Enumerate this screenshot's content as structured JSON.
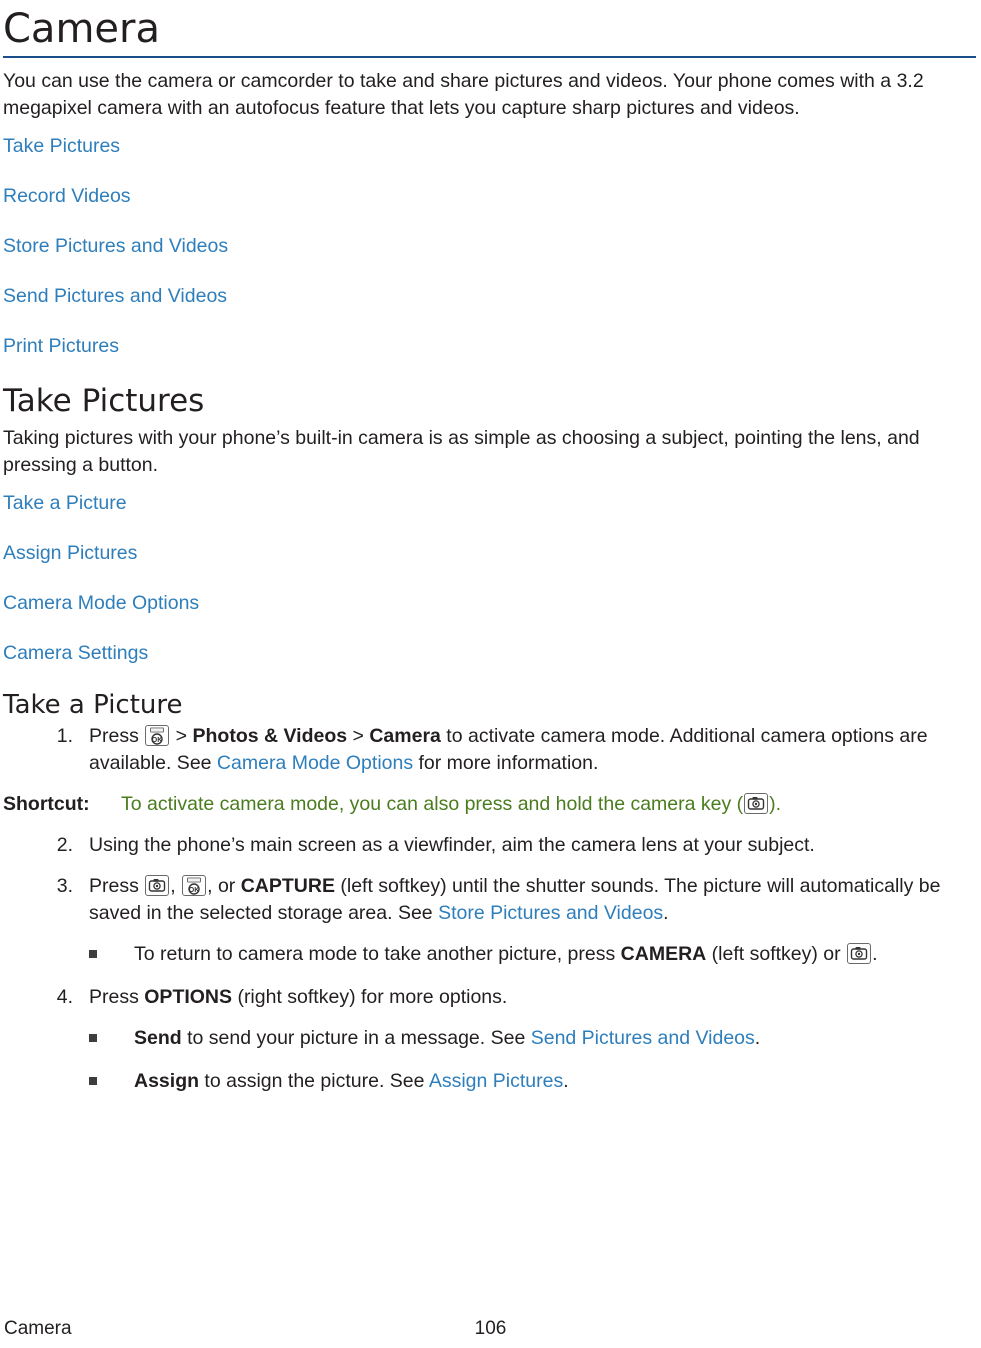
{
  "document": {
    "chapter_title": "Camera",
    "intro": "You can use the camera or camcorder to take and share pictures and videos. Your phone comes with a 3.2 megapixel camera with an autofocus feature that lets you capture sharp pictures and videos.",
    "toc_links": [
      "Take Pictures",
      "Record Videos",
      "Store Pictures and Videos",
      "Send Pictures and Videos",
      "Print Pictures"
    ],
    "section_take_pictures": {
      "heading": "Take Pictures",
      "intro": "Taking pictures with your phone’s built-in camera is as simple as choosing a subject, pointing the lens, and pressing a button.",
      "links": [
        "Take a Picture",
        "Assign Pictures",
        "Camera Mode Options",
        "Camera Settings"
      ]
    },
    "section_take_a_picture": {
      "heading": "Take a Picture",
      "steps": [
        {
          "num": "1.",
          "parts": [
            {
              "type": "text",
              "value": "Press "
            },
            {
              "type": "icon",
              "value": "ok-key-icon"
            },
            {
              "type": "text",
              "value": " > "
            },
            {
              "type": "bold",
              "value": "Photos & Videos"
            },
            {
              "type": "text",
              "value": " > "
            },
            {
              "type": "bold",
              "value": "Camera"
            },
            {
              "type": "text",
              "value": " to activate camera mode. Additional camera options are available. See "
            },
            {
              "type": "link",
              "value": "Camera Mode Options"
            },
            {
              "type": "text",
              "value": " for more information."
            }
          ]
        },
        {
          "num": "2.",
          "parts": [
            {
              "type": "text",
              "value": "Using the phone’s main screen as a viewfinder, aim the camera lens at your subject."
            }
          ]
        },
        {
          "num": "3.",
          "parts": [
            {
              "type": "text",
              "value": "Press "
            },
            {
              "type": "icon",
              "value": "camera-key-icon"
            },
            {
              "type": "text",
              "value": ", "
            },
            {
              "type": "icon",
              "value": "ok-key-icon"
            },
            {
              "type": "text",
              "value": ", or "
            },
            {
              "type": "bold",
              "value": "CAPTURE"
            },
            {
              "type": "text",
              "value": " (left softkey) until the shutter sounds. The picture will automatically be saved in the selected storage area. See "
            },
            {
              "type": "link",
              "value": "Store Pictures and Videos"
            },
            {
              "type": "text",
              "value": "."
            }
          ],
          "subitems": [
            {
              "parts": [
                {
                  "type": "text",
                  "value": "To return to camera mode to take another picture, press "
                },
                {
                  "type": "bold",
                  "value": "CAMERA"
                },
                {
                  "type": "text",
                  "value": " (left softkey) or "
                },
                {
                  "type": "icon",
                  "value": "camera-key-icon"
                },
                {
                  "type": "text",
                  "value": "."
                }
              ]
            }
          ]
        },
        {
          "num": "4.",
          "parts": [
            {
              "type": "text",
              "value": "Press "
            },
            {
              "type": "bold",
              "value": "OPTIONS"
            },
            {
              "type": "text",
              "value": " (right softkey) for more options."
            }
          ],
          "subitems": [
            {
              "parts": [
                {
                  "type": "bold",
                  "value": "Send"
                },
                {
                  "type": "text",
                  "value": " to send your picture in a message. See "
                },
                {
                  "type": "link",
                  "value": "Send Pictures and Videos"
                },
                {
                  "type": "text",
                  "value": "."
                }
              ]
            },
            {
              "parts": [
                {
                  "type": "bold",
                  "value": "Assign"
                },
                {
                  "type": "text",
                  "value": " to assign the picture. See "
                },
                {
                  "type": "link",
                  "value": "Assign Pictures"
                },
                {
                  "type": "text",
                  "value": "."
                }
              ]
            }
          ]
        }
      ],
      "shortcut": {
        "label": "Shortcut:",
        "text_before": "To activate camera mode, you can also press and hold the camera key (",
        "icon": "camera-key-icon",
        "text_after": ")."
      }
    },
    "footer": {
      "left": "Camera",
      "center": "106"
    },
    "colors": {
      "link": "#2e7ebb",
      "shortcut_green": "#4a7c1e",
      "rule_blue": "#1a4f8a",
      "body_text": "#231f20"
    }
  }
}
